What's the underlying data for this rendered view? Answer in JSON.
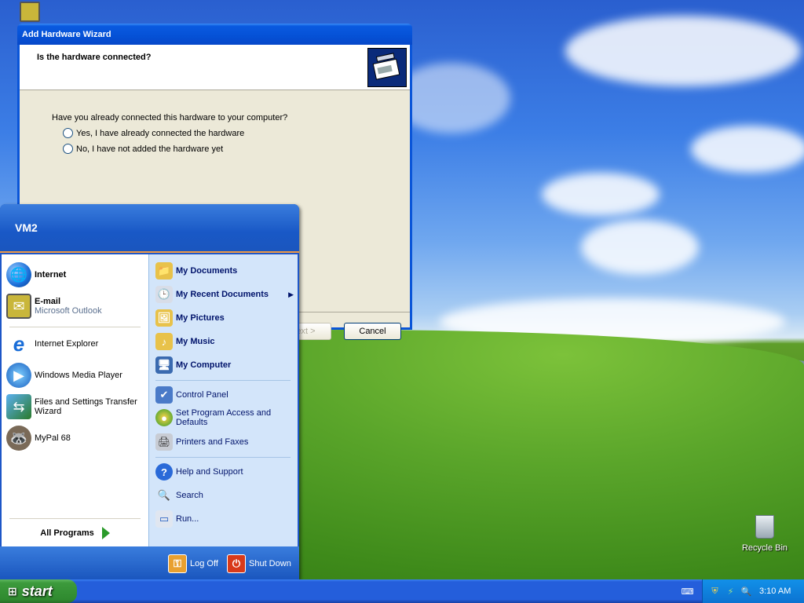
{
  "desktop": {
    "recycle_bin_label": "Recycle Bin"
  },
  "wizard": {
    "title": "Add Hardware Wizard",
    "heading": "Is the hardware connected?",
    "question": "Have you already connected this hardware to your computer?",
    "option_yes": "Yes, I have already connected the hardware",
    "option_no": "No, I have not added the hardware yet",
    "next_label": "Next >",
    "cancel_label": "Cancel"
  },
  "start_menu": {
    "user": "VM2",
    "pinned": [
      {
        "title": "Internet",
        "subtitle": ""
      },
      {
        "title": "E-mail",
        "subtitle": "Microsoft Outlook"
      }
    ],
    "recent": [
      "Internet Explorer",
      "Windows Media Player",
      "Files and Settings Transfer Wizard",
      "MyPal 68"
    ],
    "all_programs": "All Programs",
    "right_group1": [
      "My Documents",
      "My Recent Documents",
      "My Pictures",
      "My Music",
      "My Computer"
    ],
    "right_group2": [
      "Control Panel",
      "Set Program Access and Defaults",
      "Printers and Faxes"
    ],
    "right_group3": [
      "Help and Support",
      "Search",
      "Run..."
    ],
    "log_off": "Log Off",
    "shut_down": "Shut Down"
  },
  "taskbar": {
    "start_label": "start",
    "clock": "3:10 AM"
  },
  "icons": {
    "internet": "globe-icon",
    "email": "outlook-icon",
    "ie": "ie-icon",
    "wmp": "media-player-icon",
    "transfer": "transfer-wizard-icon",
    "mypal": "raccoon-icon"
  }
}
